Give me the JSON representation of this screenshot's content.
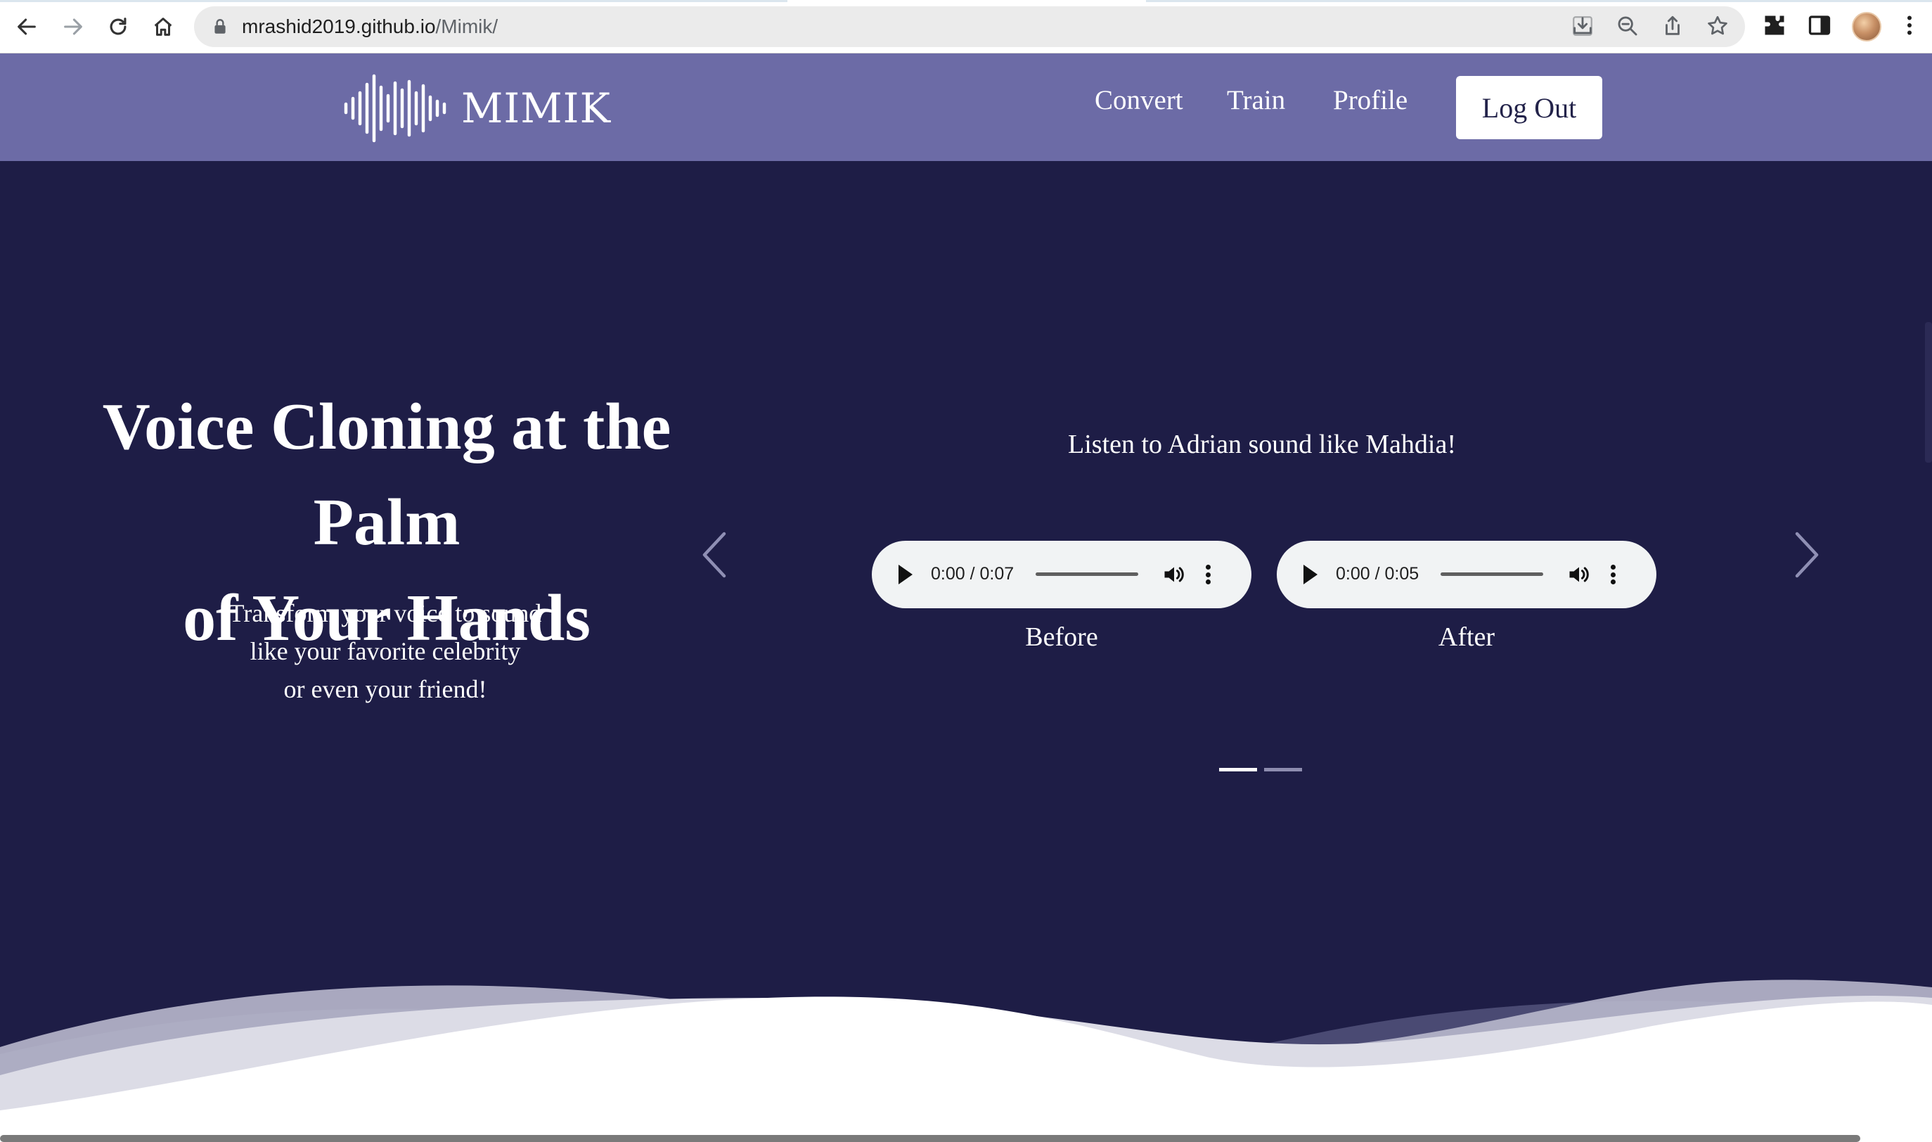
{
  "browser": {
    "url_host": "mrashid2019.github.io",
    "url_path": "/Mimik/",
    "icons": [
      "back-icon",
      "forward-icon",
      "reload-icon",
      "home-icon",
      "lock-icon",
      "install-icon",
      "zoom-icon",
      "share-icon",
      "bookmark-star-icon",
      "extensions-icon",
      "side-panel-icon",
      "profile-avatar",
      "kebab-menu-icon"
    ]
  },
  "nav": {
    "brand": "MIMIK",
    "links": [
      "Convert",
      "Train",
      "Profile"
    ],
    "logout_label": "Log Out",
    "background": "#6c6ba6"
  },
  "hero": {
    "background": "#1e1d46",
    "headline_line1": "Voice Cloning at the Palm",
    "headline_line2": "of Your Hands",
    "sub_line1": "Transform your voice to sound",
    "sub_line2": "like your favorite celebrity",
    "sub_line3": "or even your friend!"
  },
  "carousel": {
    "title": "Listen to Adrian sound like Mahdia!",
    "players": [
      {
        "time": "0:00 / 0:07",
        "caption": "Before"
      },
      {
        "time": "0:00 / 0:05",
        "caption": "After"
      }
    ],
    "slides": 2,
    "active_slide": 1
  }
}
